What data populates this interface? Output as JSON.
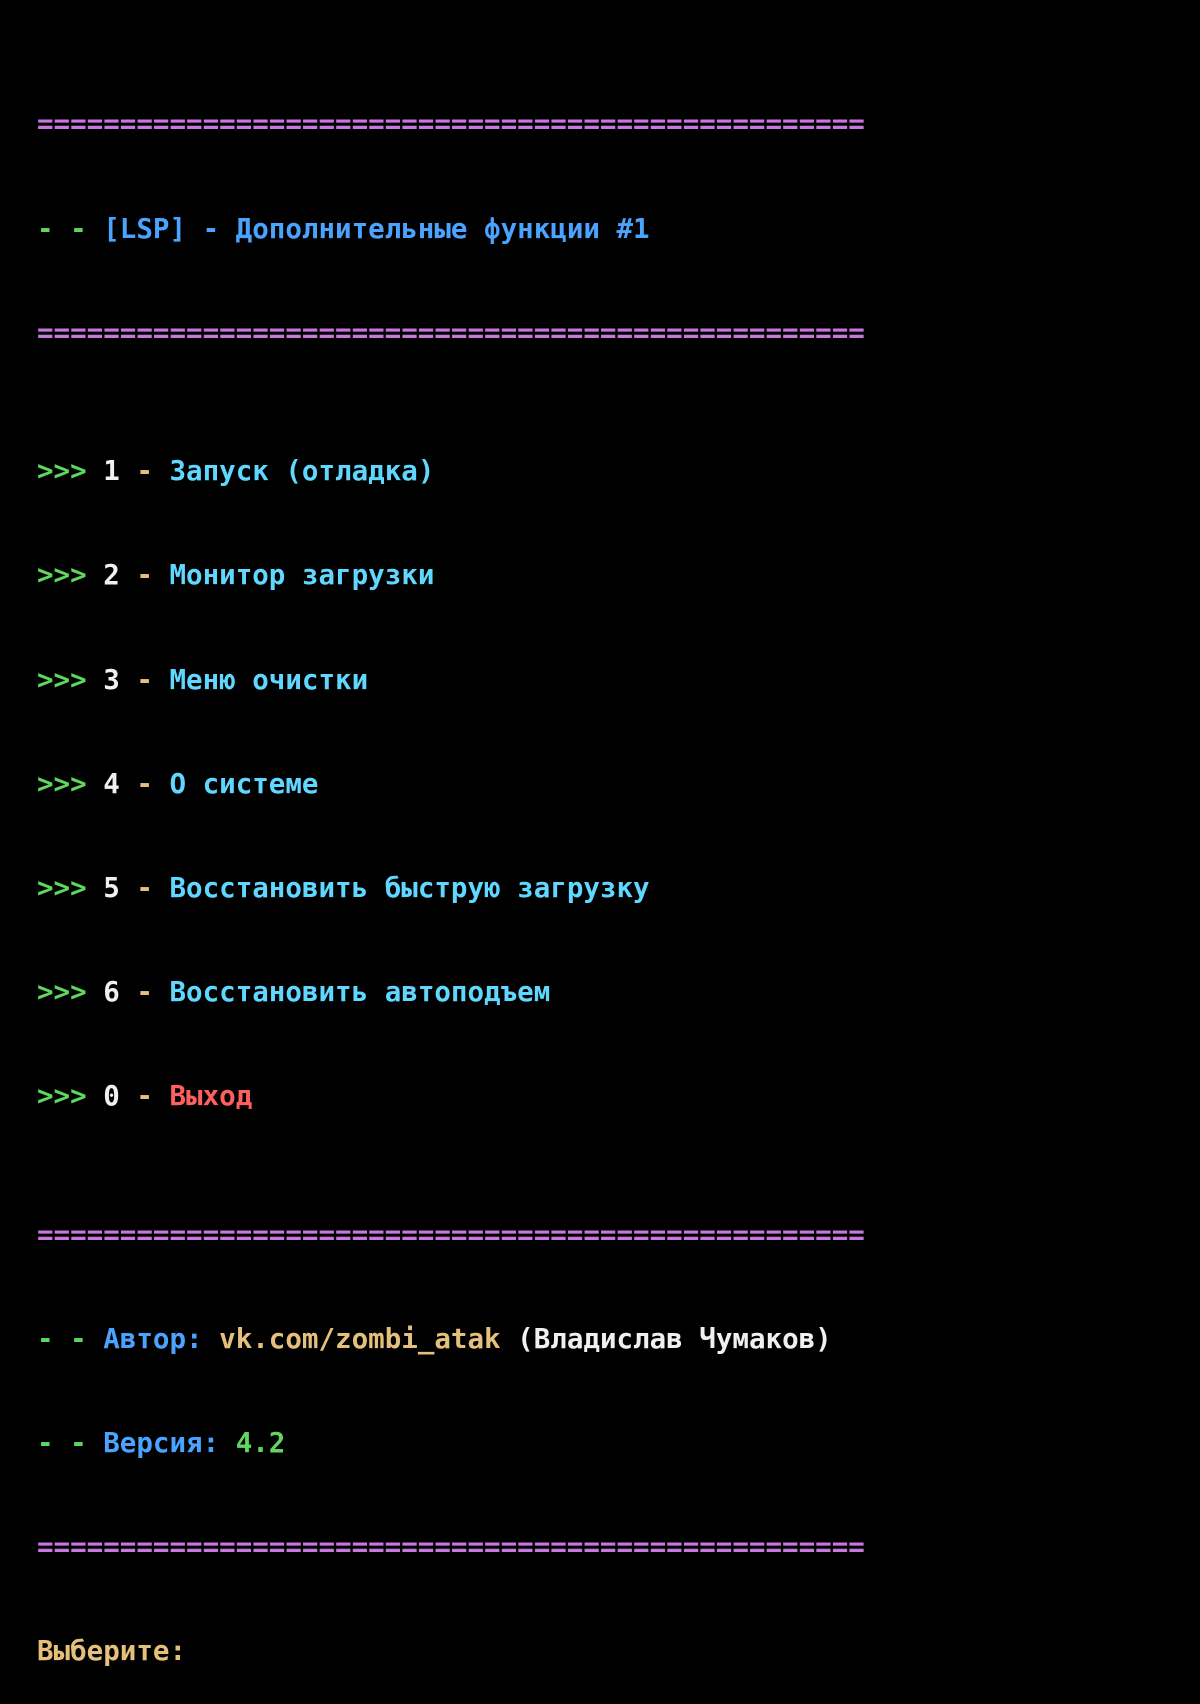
{
  "separator": "==================================================",
  "header": {
    "prefix": "- - ",
    "title": "[LSP] - Дополнительные функции #1"
  },
  "menu": {
    "arrow": ">>> ",
    "dash": " - ",
    "items": [
      {
        "key": "1",
        "label": "Запуск (отладка)"
      },
      {
        "key": "2",
        "label": "Монитор загрузки"
      },
      {
        "key": "3",
        "label": "Меню очистки"
      },
      {
        "key": "4",
        "label": "О системе"
      },
      {
        "key": "5",
        "label": "Восстановить быструю загрузку"
      },
      {
        "key": "6",
        "label": "Восстановить автоподъем"
      },
      {
        "key": "0",
        "label": "Выход"
      }
    ]
  },
  "info": {
    "prefix": "- - ",
    "author_label": "Автор: ",
    "author_link": "vk.com/zombi_atak",
    "author_name": " (Владислав Чумаков)",
    "version_label": "Версия: ",
    "version_value": "4.2"
  },
  "prompt": "Выберите:",
  "colors": {
    "separator": "#c678dd",
    "arrow": "#5fd75f",
    "title": "#4aa3ff",
    "menu_label": "#5fd7ff",
    "exit_label": "#ff5f5f",
    "prompt": "#e5c07b"
  }
}
